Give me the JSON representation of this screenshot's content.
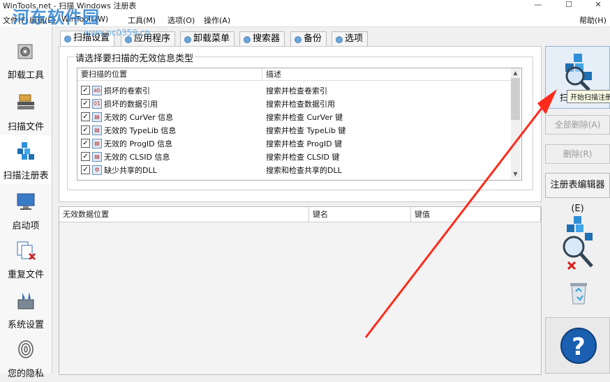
{
  "window": {
    "title": "WinTools.net - 扫描 Windows 注册表",
    "help": "帮助(H)",
    "controls": [
      "—",
      "☐",
      "✕"
    ]
  },
  "watermark": {
    "text": "河东软件园",
    "url": "www.pc0359.cn"
  },
  "menu": [
    {
      "label": "文件(F)"
    },
    {
      "label": "编辑(E)"
    },
    {
      "label": "WinTools(W)"
    },
    {
      "label": "工具(M)"
    },
    {
      "label": "选项(O)"
    },
    {
      "label": "操作(A)"
    }
  ],
  "sidebar": [
    {
      "label": "卸载工具",
      "icon": "uninstall-icon"
    },
    {
      "label": "扫描文件",
      "icon": "scan-files-icon"
    },
    {
      "label": "扫描注册表",
      "icon": "scan-registry-icon",
      "active": true
    },
    {
      "label": "启动项",
      "icon": "startup-icon"
    },
    {
      "label": "重复文件",
      "icon": "duplicate-files-icon"
    },
    {
      "label": "系统设置",
      "icon": "system-settings-icon"
    },
    {
      "label": "您的隐私",
      "icon": "privacy-icon"
    }
  ],
  "tabs": [
    {
      "label": "扫描设置",
      "active": true
    },
    {
      "label": "应用程序"
    },
    {
      "label": "卸载菜单"
    },
    {
      "label": "搜索器"
    },
    {
      "label": "备份"
    },
    {
      "label": "选项"
    }
  ],
  "scan_settings": {
    "group_title": "请选择要扫描的无效信息类型",
    "columns": [
      "要扫描的位置",
      "描述"
    ],
    "rows": [
      {
        "name": "损坏的卷索引",
        "desc": "搜索并检查卷索引",
        "icon": "ab"
      },
      {
        "name": "损坏的数据引用",
        "desc": "搜索并检查数据引用",
        "icon": "011"
      },
      {
        "name": "无效的 CurVer 信息",
        "desc": "搜索并检查 CurVer 键",
        "icon": "doc"
      },
      {
        "name": "无效的 TypeLib 信息",
        "desc": "搜索并检查 TypeLib 键",
        "icon": "doc"
      },
      {
        "name": "无效的 ProgID 信息",
        "desc": "搜索并检查 ProgID 键",
        "icon": "doc"
      },
      {
        "name": "无效的 CLSID 信息",
        "desc": "搜索并检查 CLSID 键",
        "icon": "doc"
      },
      {
        "name": "缺少共享的DLL",
        "desc": "搜索和检查共享的DLL",
        "icon": "gear"
      }
    ]
  },
  "results": {
    "columns": [
      "无效数据位置",
      "键名",
      "键值"
    ]
  },
  "actions": {
    "scan_label": "扫描",
    "tooltip": "开始扫描注册",
    "delete_all": "全部删除(A)",
    "delete": "删除(R)",
    "regedit": "注册表编辑器(E)",
    "help": "?"
  },
  "colors": {
    "accent": "#2a7fd0",
    "arrow": "#ff2a1a",
    "help": "#1a5fb0"
  }
}
